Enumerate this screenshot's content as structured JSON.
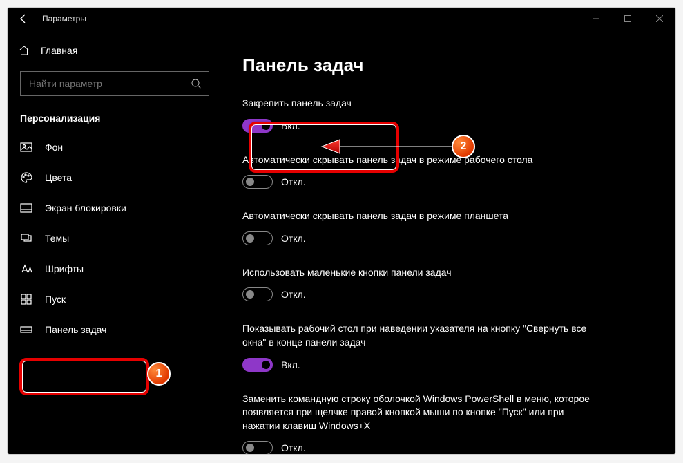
{
  "titlebar": {
    "app_title": "Параметры"
  },
  "sidebar": {
    "home_label": "Главная",
    "search_placeholder": "Найти параметр",
    "section_title": "Персонализация",
    "items": [
      {
        "label": "Фон"
      },
      {
        "label": "Цвета"
      },
      {
        "label": "Экран блокировки"
      },
      {
        "label": "Темы"
      },
      {
        "label": "Шрифты"
      },
      {
        "label": "Пуск"
      },
      {
        "label": "Панель задач"
      }
    ]
  },
  "content": {
    "page_title": "Панель задач",
    "settings": [
      {
        "label": "Закрепить панель задач",
        "state": "Вкл.",
        "on": true
      },
      {
        "label": "Автоматически скрывать панель задач в режиме рабочего стола",
        "state": "Откл.",
        "on": false
      },
      {
        "label": "Автоматически скрывать панель задач в режиме планшета",
        "state": "Откл.",
        "on": false
      },
      {
        "label": "Использовать маленькие кнопки панели задач",
        "state": "Откл.",
        "on": false
      },
      {
        "label": "Показывать рабочий стол при наведении указателя на кнопку \"Свернуть все окна\" в конце панели задач",
        "state": "Вкл.",
        "on": true
      },
      {
        "label": "Заменить командную строку оболочкой Windows PowerShell в меню, которое появляется при щелчке правой кнопкой мыши по кнопке \"Пуск\" или при нажатии клавиш Windows+X",
        "state": "Откл.",
        "on": false
      }
    ]
  },
  "annotations": {
    "marker1": "1",
    "marker2": "2"
  },
  "colors": {
    "accent": "#8e37c8",
    "annotation_red": "#e60000"
  }
}
